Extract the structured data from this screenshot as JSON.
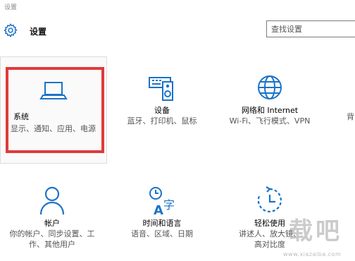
{
  "window": {
    "title": "设置"
  },
  "header": {
    "title": "设置",
    "icon": "gear-icon"
  },
  "search": {
    "placeholder": "查找设置",
    "value": ""
  },
  "colors": {
    "accent": "#1a73c8",
    "highlight": "#e03a3a"
  },
  "tiles": [
    {
      "name": "系统",
      "desc": "显示、通知、应用、电源",
      "icon": "laptop-icon"
    },
    {
      "name": "设备",
      "desc": "蓝牙、打印机、鼠标",
      "icon": "devices-icon"
    },
    {
      "name": "网络和 Internet",
      "desc": "Wi-Fi、飞行模式、VPN",
      "icon": "globe-icon"
    },
    {
      "name": "",
      "desc": "背",
      "icon": "personalization-icon"
    },
    {
      "name": "帐户",
      "desc": "你的帐户、同步设置、工作、其他用户",
      "icon": "person-icon"
    },
    {
      "name": "时间和语言",
      "desc": "语音、区域、日期",
      "icon": "time-language-icon"
    },
    {
      "name": "轻松使用",
      "desc": "讲述人、放大镜、高对比度",
      "icon": "ease-of-access-icon"
    }
  ],
  "watermark": {
    "text": "载吧",
    "url_text": "www.xiazaiba.com"
  }
}
